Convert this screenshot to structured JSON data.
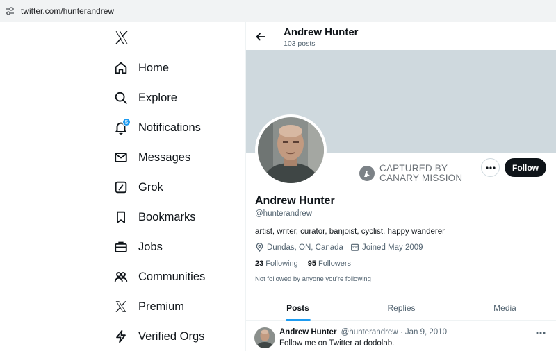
{
  "browser": {
    "url": "twitter.com/hunterandrew"
  },
  "nav": {
    "items": [
      {
        "label": "Home",
        "icon": "home-icon"
      },
      {
        "label": "Explore",
        "icon": "search-icon"
      },
      {
        "label": "Notifications",
        "icon": "bell-icon",
        "badge": "5"
      },
      {
        "label": "Messages",
        "icon": "envelope-icon"
      },
      {
        "label": "Grok",
        "icon": "grok-icon"
      },
      {
        "label": "Bookmarks",
        "icon": "bookmark-icon"
      },
      {
        "label": "Jobs",
        "icon": "briefcase-icon"
      },
      {
        "label": "Communities",
        "icon": "people-icon"
      },
      {
        "label": "Premium",
        "icon": "x-logo-icon"
      },
      {
        "label": "Verified Orgs",
        "icon": "lightning-icon"
      }
    ]
  },
  "header": {
    "name": "Andrew Hunter",
    "posts": "103 posts"
  },
  "watermark": {
    "line1": "CAPTURED BY",
    "line2": "CANARY MISSION"
  },
  "profile": {
    "name": "Andrew Hunter",
    "handle": "@hunterandrew",
    "bio": "artist, writer, curator, banjoist, cyclist, happy wanderer",
    "location": "Dundas, ON, Canada",
    "joined": "Joined May 2009",
    "following_count": "23",
    "following_label": "Following",
    "followers_count": "95",
    "followers_label": "Followers",
    "not_followed": "Not followed by anyone you’re following",
    "follow_label": "Follow"
  },
  "tabs": [
    {
      "label": "Posts",
      "active": true
    },
    {
      "label": "Replies",
      "active": false
    },
    {
      "label": "Media",
      "active": false
    }
  ],
  "tweet": {
    "name": "Andrew Hunter",
    "handle": "@hunterandrew",
    "separator": "·",
    "date": "Jan 9, 2010",
    "text": "Follow me on Twitter at dodolab."
  },
  "colors": {
    "accent": "#1d9bf0",
    "banner": "#cfd9de",
    "follow_button": "#0f1419"
  }
}
